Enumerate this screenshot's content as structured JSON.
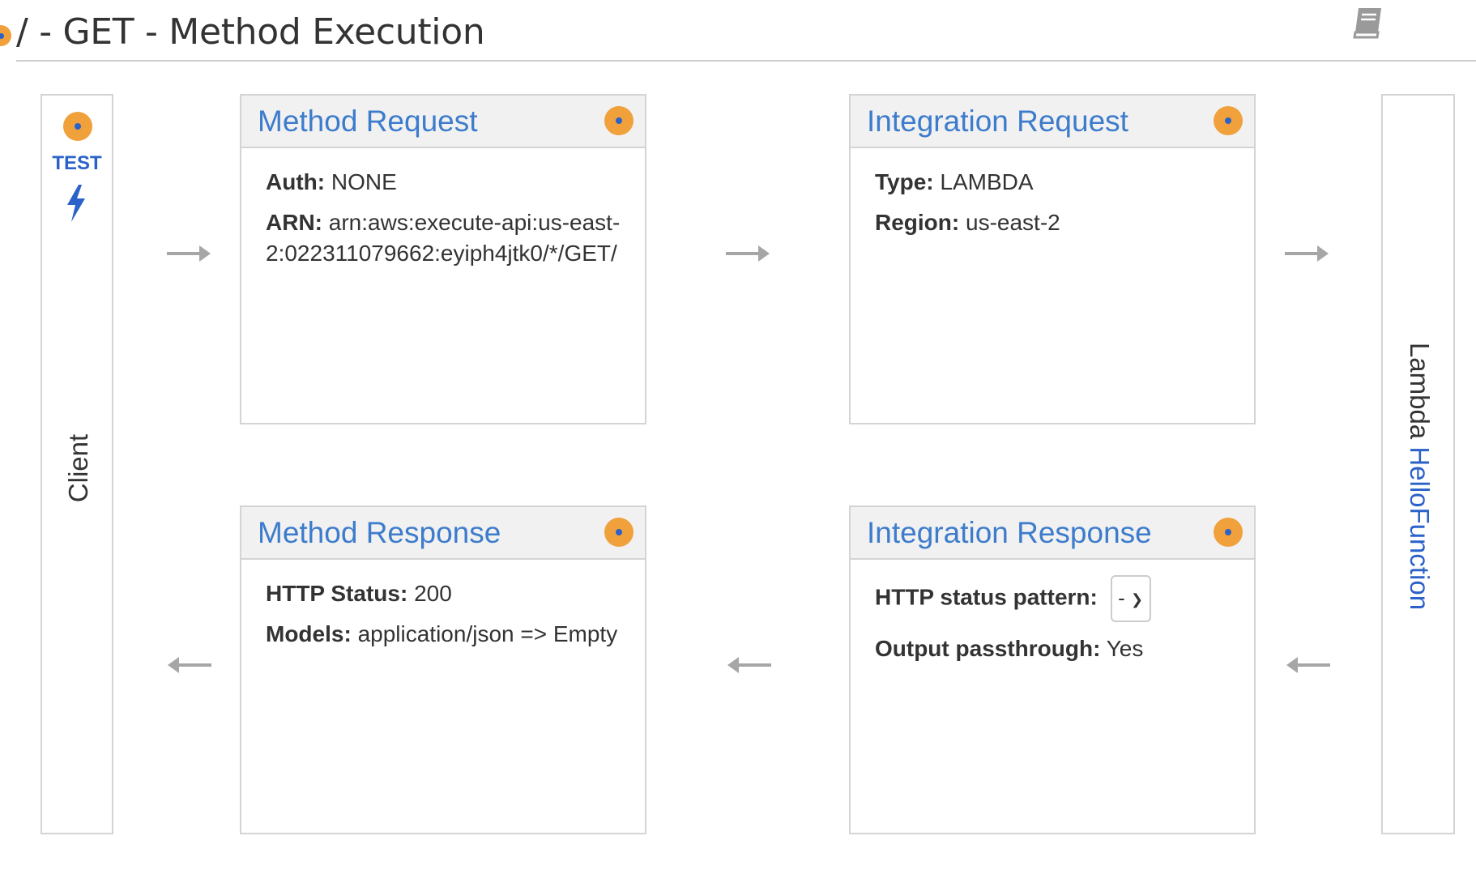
{
  "header": {
    "title": "/ - GET - Method Execution",
    "docs_icon": "book-icon"
  },
  "client": {
    "label": "Client",
    "test_label": "TEST",
    "test_icon": "lightning-bolt-icon"
  },
  "backend": {
    "prefix": "Lambda",
    "function_name": "HelloFunction"
  },
  "method_request": {
    "title": "Method Request",
    "rows": [
      {
        "label": "Auth:",
        "value": "NONE"
      },
      {
        "label": "ARN:",
        "value": "arn:aws:execute-api:us-east-2:022311079662:eyiph4jtk0/*/GET/"
      }
    ]
  },
  "integration_request": {
    "title": "Integration Request",
    "rows": [
      {
        "label": "Type:",
        "value": "LAMBDA"
      },
      {
        "label": "Region:",
        "value": "us-east-2"
      }
    ]
  },
  "method_response": {
    "title": "Method Response",
    "rows": [
      {
        "label": "HTTP Status:",
        "value": "200"
      },
      {
        "label": "Models:",
        "value": "application/json => Empty"
      }
    ]
  },
  "integration_response": {
    "title": "Integration Response",
    "status_pattern_label": "HTTP status pattern:",
    "status_pattern_value": "-",
    "passthrough_label": "Output passthrough:",
    "passthrough_value": "Yes"
  },
  "colors": {
    "accent": "#3d7ccc",
    "link": "#2b62c9",
    "indicator": "#f0a13c",
    "border": "#d4d4d4",
    "header_bg": "#f1f1f1",
    "arrow": "#a6a6a6"
  }
}
